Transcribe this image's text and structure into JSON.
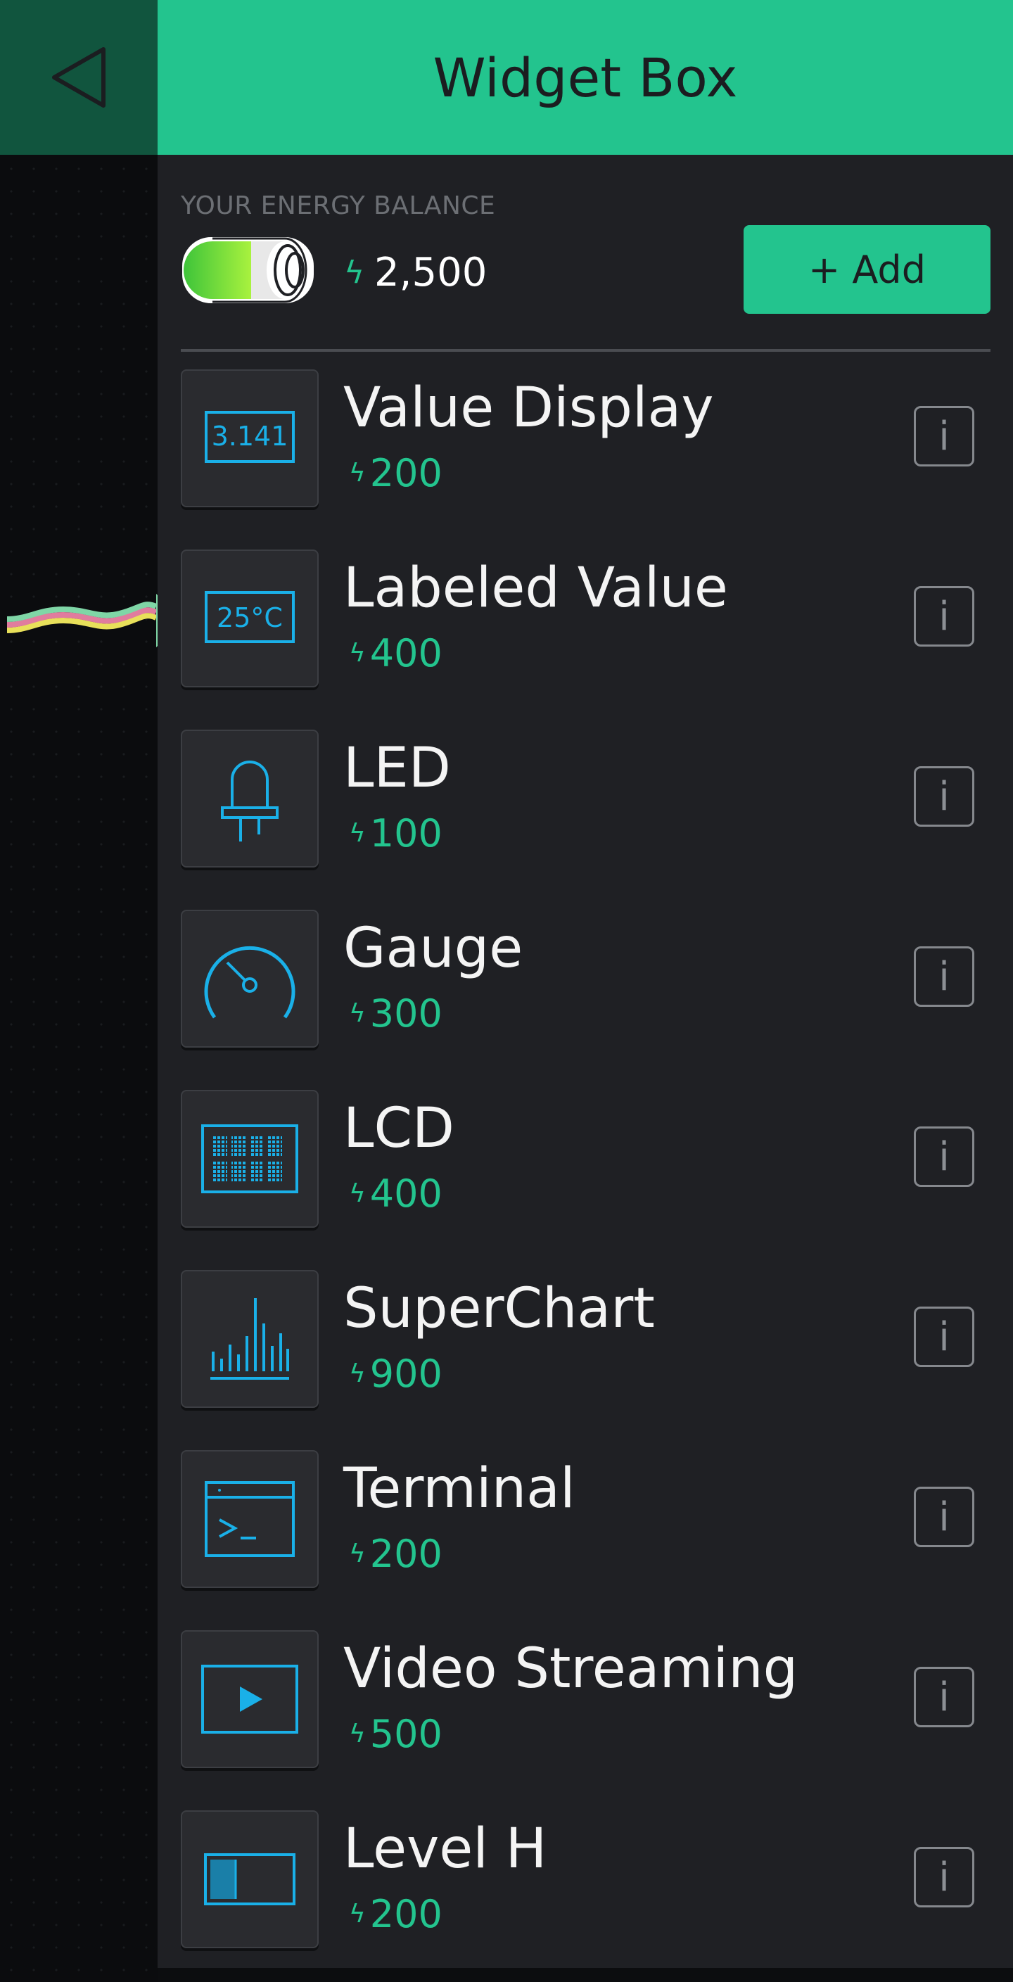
{
  "header": {
    "title": "Widget Box"
  },
  "energy": {
    "label": "YOUR ENERGY BALANCE",
    "value": "2,500",
    "add_label": "+ Add"
  },
  "colors": {
    "accent": "#23c48e",
    "widget_icon": "#1ab0e8",
    "panel": "#1f2024"
  },
  "widgets": [
    {
      "name": "Value Display",
      "cost": "200",
      "icon": "value-display-icon",
      "icon_text": "3.141"
    },
    {
      "name": "Labeled Value",
      "cost": "400",
      "icon": "labeled-value-icon",
      "icon_text": "25°C"
    },
    {
      "name": "LED",
      "cost": "100",
      "icon": "led-icon"
    },
    {
      "name": "Gauge",
      "cost": "300",
      "icon": "gauge-icon"
    },
    {
      "name": "LCD",
      "cost": "400",
      "icon": "lcd-icon"
    },
    {
      "name": "SuperChart",
      "cost": "900",
      "icon": "superchart-icon"
    },
    {
      "name": "Terminal",
      "cost": "200",
      "icon": "terminal-icon"
    },
    {
      "name": "Video Streaming",
      "cost": "500",
      "icon": "video-streaming-icon"
    },
    {
      "name": "Level H",
      "cost": "200",
      "icon": "level-h-icon"
    }
  ]
}
